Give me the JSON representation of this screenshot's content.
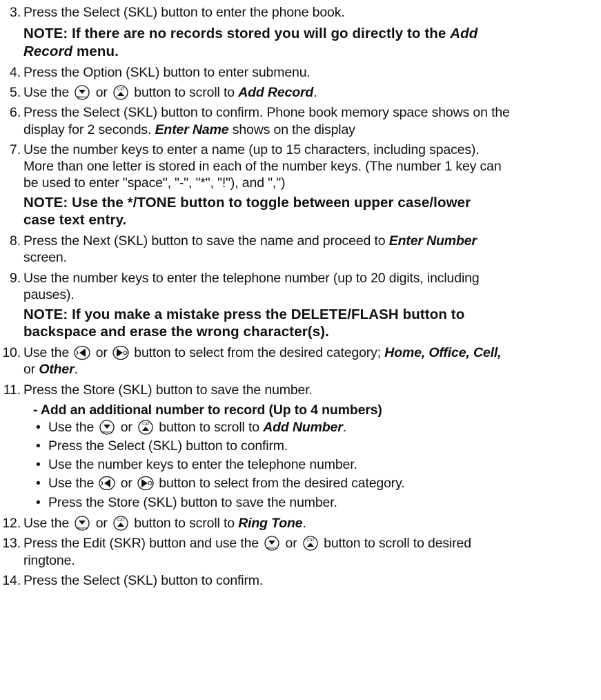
{
  "steps": [
    {
      "num": "3.",
      "pre": "Press the Select (SKL) button to enter the phone book."
    },
    {
      "note": "NOTE: If there are no records stored you will go directly to the ",
      "note_em": "Add",
      "note2_em": "Record",
      "note2": " menu."
    },
    {
      "num": "4.",
      "pre": "Press the Option (SKL) button to enter submenu."
    },
    {
      "num": "5.",
      "pre": "Use the ",
      "mid": " or ",
      "post": " button to scroll to ",
      "em": "Add Record",
      "end": "."
    },
    {
      "num": "6.",
      "pre": "Press the Select (SKL) button to confirm. Phone book memory space shows on the",
      "cont_pre": "display for 2 seconds. ",
      "cont_em": "Enter Name",
      "cont_end": " shows on the display"
    },
    {
      "num": "7.",
      "pre": "Use the number keys to enter a name (up to 15 characters, including spaces).",
      "cont1": "More than one letter is stored in each of the number keys. (The number 1 key can",
      "cont2": "be used to enter \"space\", \"-\", \"*\", \"!\"), and \",\")"
    },
    {
      "note": "NOTE: Use the */TONE button to toggle between upper case/lower",
      "note2": "case text entry."
    },
    {
      "num": "8.",
      "pre": "Press the Next (SKL) button to save the name and proceed to ",
      "em": "Enter Number",
      "cont": "screen."
    },
    {
      "num": "9.",
      "pre": "Use the number keys to enter the telephone number (up to 20 digits, including",
      "cont": "pauses)."
    },
    {
      "note": "NOTE: If you make a mistake press the DELETE/FLASH button to",
      "note2": "backspace and erase the wrong character(s)."
    },
    {
      "num": "10.",
      "pre": "Use the ",
      "mid": " or ",
      "post": " button to select from the desired category; ",
      "em": "Home, Office, Cell,",
      "cont_pre": "or ",
      "cont_em": "Other",
      "cont_end": "."
    },
    {
      "num": "11.",
      "pre": "Press the Store (SKL) button to save the number."
    },
    {
      "sub": "- Add an additional number to record (Up to 4 numbers)"
    },
    {
      "bullets": [
        {
          "pre": "Use the ",
          "mid": " or ",
          "post": " button to scroll to ",
          "em": "Add Number",
          "end": "."
        },
        {
          "text": "Press the Select (SKL) button to confirm."
        },
        {
          "text": "Use the number keys to enter the telephone number."
        },
        {
          "pre": "Use the ",
          "mid": " or ",
          "post": " button to select from the desired category."
        },
        {
          "text": "Press the Store (SKL) button to save the number."
        }
      ]
    },
    {
      "num": "12.",
      "pre": "Use the ",
      "mid": " or ",
      "post": " button to scroll to ",
      "em": "Ring Tone",
      "end": "."
    },
    {
      "num": "13.",
      "pre": "Press the Edit (SKR) button and use the ",
      "mid": " or ",
      "post": " button to scroll to desired",
      "cont": "ringtone."
    },
    {
      "num": "14.",
      "pre": "Press the Select (SKL) button to confirm."
    }
  ],
  "bullet_char": "•",
  "icons": {
    "down": "redial-down-arrow-icon",
    "up": "cid-up-arrow-icon",
    "left": "left-arrow-icon",
    "right": "right-arrow-icon"
  }
}
